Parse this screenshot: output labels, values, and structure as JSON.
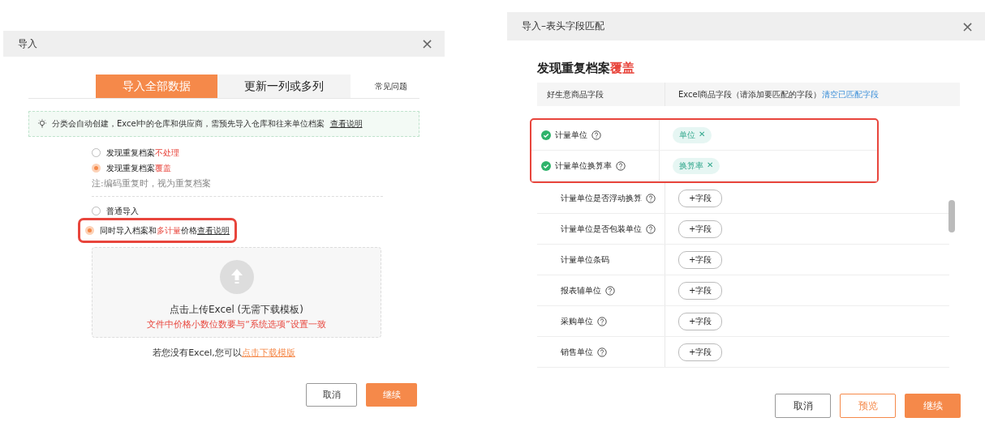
{
  "import_dialog": {
    "title": "导入",
    "close": "×",
    "tabs": [
      {
        "label": "导入全部数据",
        "selected": true
      },
      {
        "label": "更新一列或多列",
        "selected": false
      }
    ],
    "faq": "常见问题",
    "tip": {
      "text": "分类会自动创建，Excel中的仓库和供应商，需预先导入仓库和往来单位档案",
      "link": "查看说明"
    },
    "duplicate_options": [
      {
        "selected": false,
        "highlighted": false,
        "parts": [
          {
            "kind": "plain",
            "text": "发现重复档案"
          },
          {
            "kind": "red",
            "text": "不处理"
          }
        ]
      },
      {
        "selected": true,
        "highlighted": false,
        "parts": [
          {
            "kind": "plain",
            "text": "发现重复档案"
          },
          {
            "kind": "red",
            "text": "覆盖"
          }
        ]
      }
    ],
    "note": "注:编码重复时，视为重复档案",
    "import_options": [
      {
        "selected": false,
        "highlighted": false,
        "parts": [
          {
            "kind": "plain",
            "text": "普通导入"
          }
        ]
      },
      {
        "selected": true,
        "highlighted": true,
        "parts": [
          {
            "kind": "plain",
            "text": "同时导入档案和"
          },
          {
            "kind": "red",
            "text": "多计量"
          },
          {
            "kind": "plain",
            "text": "价格"
          },
          {
            "kind": "link",
            "text": "查看说明"
          }
        ]
      }
    ],
    "upload": {
      "title": "点击上传Excel (无需下载模板)",
      "warning": "文件中价格小数位数要与“系统选项”设置一致"
    },
    "template_hint": {
      "text": "若您没有Excel,您可以",
      "link": "点击下载模版"
    },
    "buttons": [
      {
        "label": "取消",
        "kind": "secondary"
      },
      {
        "label": "继续",
        "kind": "primary"
      }
    ]
  },
  "match_dialog": {
    "title": "导入–表头字段匹配",
    "close": "×",
    "heading": {
      "text": "发现重复档案",
      "highlight": "覆盖"
    },
    "columns": [
      {
        "label": "好生意商品字段"
      },
      {
        "label": "Excel商品字段（请添加要匹配的字段）",
        "link": "清空已匹配字段"
      }
    ],
    "rows": [
      {
        "field": "计量单位",
        "help": true,
        "matched": true,
        "highlighted": true,
        "value": "单位",
        "remove": "✕"
      },
      {
        "field": "计量单位换算率",
        "help": true,
        "matched": true,
        "highlighted": true,
        "value": "换算率",
        "remove": "✕"
      },
      {
        "field": "计量单位是否浮动换算",
        "help": true,
        "matched": false,
        "highlighted": false,
        "value": "+字段"
      },
      {
        "field": "计量单位是否包装单位",
        "help": true,
        "matched": false,
        "highlighted": false,
        "value": "+字段"
      },
      {
        "field": "计量单位条码",
        "help": false,
        "matched": false,
        "highlighted": false,
        "value": "+字段"
      },
      {
        "field": "报表辅单位",
        "help": true,
        "matched": false,
        "highlighted": false,
        "value": "+字段"
      },
      {
        "field": "采购单位",
        "help": true,
        "matched": false,
        "highlighted": false,
        "value": "+字段"
      },
      {
        "field": "销售单位",
        "help": true,
        "matched": false,
        "highlighted": false,
        "value": "+字段"
      }
    ],
    "buttons": [
      {
        "label": "取消",
        "kind": "secondary"
      },
      {
        "label": "预览",
        "kind": "outline"
      },
      {
        "label": "继续",
        "kind": "primary"
      }
    ]
  }
}
